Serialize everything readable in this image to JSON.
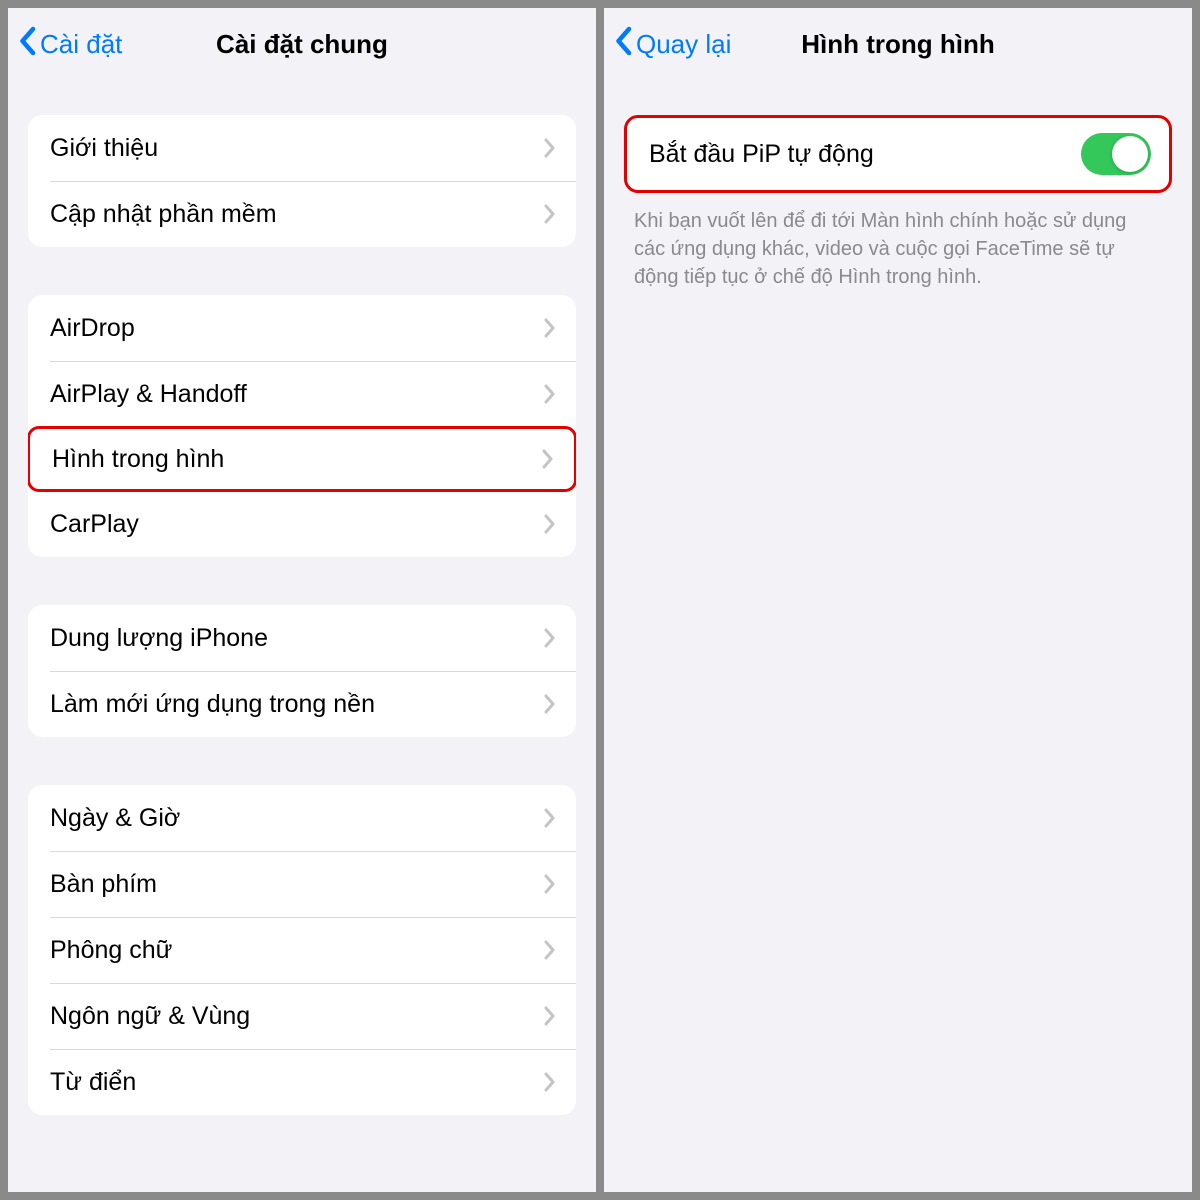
{
  "leftScreen": {
    "back": "Cài đặt",
    "title": "Cài đặt chung",
    "groups": [
      {
        "rows": [
          {
            "label": "Giới thiệu",
            "highlight": false
          },
          {
            "label": "Cập nhật phần mềm",
            "highlight": false
          }
        ]
      },
      {
        "rows": [
          {
            "label": "AirDrop",
            "highlight": false
          },
          {
            "label": "AirPlay & Handoff",
            "highlight": false
          },
          {
            "label": "Hình trong hình",
            "highlight": true
          },
          {
            "label": "CarPlay",
            "highlight": false
          }
        ]
      },
      {
        "rows": [
          {
            "label": "Dung lượng iPhone",
            "highlight": false
          },
          {
            "label": "Làm mới ứng dụng trong nền",
            "highlight": false
          }
        ]
      },
      {
        "rows": [
          {
            "label": "Ngày & Giờ",
            "highlight": false
          },
          {
            "label": "Bàn phím",
            "highlight": false
          },
          {
            "label": "Phông chữ",
            "highlight": false
          },
          {
            "label": "Ngôn ngữ & Vùng",
            "highlight": false
          },
          {
            "label": "Từ điển",
            "highlight": false
          }
        ]
      }
    ]
  },
  "rightScreen": {
    "back": "Quay lại",
    "title": "Hình trong hình",
    "toggleRow": {
      "label": "Bắt đầu PiP tự động",
      "on": true
    },
    "footer": "Khi bạn vuốt lên để đi tới Màn hình chính hoặc sử dụng các ứng dụng khác, video và cuộc gọi FaceTime sẽ tự động tiếp tục ở chế độ Hình trong hình."
  },
  "colors": {
    "tint": "#007aff",
    "toggleOn": "#34c759",
    "highlight": "#e30000"
  }
}
